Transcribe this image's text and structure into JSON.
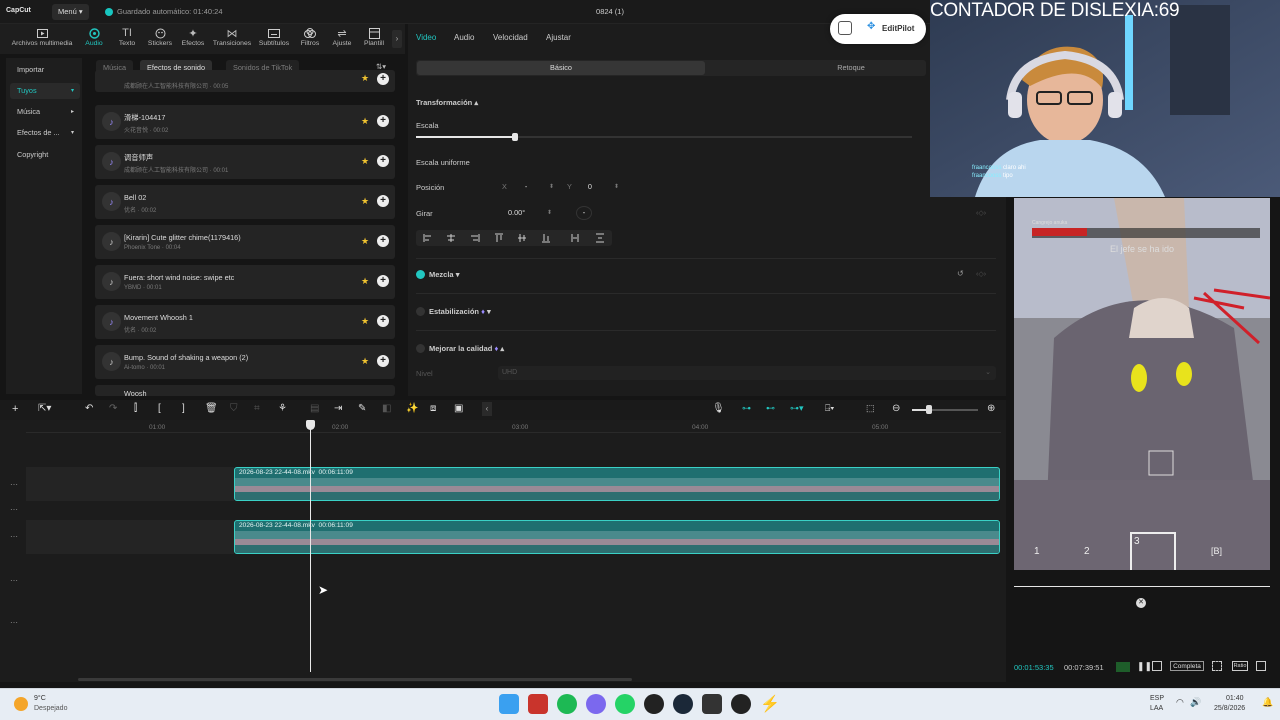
{
  "app": {
    "logo": "CapCut",
    "menu": "Menú",
    "autosave": "Guardado automático: 01:40:24",
    "project_title": "0824 (1)"
  },
  "media_tabs": [
    {
      "label": "Archivos multimedia",
      "icon": "media-icon"
    },
    {
      "label": "Audio",
      "icon": "audio-icon"
    },
    {
      "label": "Texto",
      "icon": "text-icon"
    },
    {
      "label": "Stickers",
      "icon": "sticker-icon"
    },
    {
      "label": "Efectos",
      "icon": "effects-icon"
    },
    {
      "label": "Transiciones",
      "icon": "transition-icon"
    },
    {
      "label": "Subtítulos",
      "icon": "subtitles-icon"
    },
    {
      "label": "Filtros",
      "icon": "filter-icon"
    },
    {
      "label": "Ajuste",
      "icon": "adjust-icon"
    },
    {
      "label": "Plantill",
      "icon": "template-icon"
    }
  ],
  "sidebar": {
    "items": [
      "Importar",
      "Tuyos",
      "Música",
      "Efectos de ...",
      "Copyright"
    ]
  },
  "subtabs": [
    "Música",
    "Efectos de sonido",
    "Sonidos de TikTok"
  ],
  "sounds": [
    {
      "title": "",
      "sub": "成都顾在人工智能科技有限公司 · 00:05"
    },
    {
      "title": "滑梯-104417",
      "sub": "火花音悦 · 00:02"
    },
    {
      "title": "调音师声",
      "sub": "成都顾在人工智能科技有限公司 · 00:01"
    },
    {
      "title": "Bell 02",
      "sub": "优名 · 00:02"
    },
    {
      "title": "[Kirarin] Cute glitter chime(1179416)",
      "sub": "Phoenix Tone · 00:04"
    },
    {
      "title": "Fuera: short wind noise: swipe etc",
      "sub": "YBMD · 00:01"
    },
    {
      "title": "Movement Whoosh 1",
      "sub": "优名 · 00:02"
    },
    {
      "title": "Bump. Sound of shaking a weapon (2)",
      "sub": "Ai-tomo · 00:01"
    },
    {
      "title": "Woosh",
      "sub": ""
    }
  ],
  "props": {
    "tabs": [
      "Video",
      "Audio",
      "Velocidad",
      "Ajustar"
    ],
    "segments": [
      "Básico",
      "Retoque"
    ],
    "transform": "Transformación",
    "scale": "Escala",
    "uniform_scale": "Escala uniforme",
    "position": "Posición",
    "x_label": "X",
    "x_value": "-",
    "y_label": "Y",
    "y_value": "0",
    "rotate": "Girar",
    "rotate_value": "0.00°",
    "rotate_dash": "-",
    "blend": "Mezcla",
    "stabilization": "Estabilización",
    "enhance": "Mejorar la calidad",
    "level_label": "Nivel",
    "level_value": "UHD",
    "scale_level": 0.2
  },
  "editpilot": "EditPilot",
  "overlay": {
    "counter": "CONTADOR DE DISLEXIA:69",
    "chat1_user": "fraancooss",
    "chat1_msg": "claro ahi",
    "chat2_user": "fraancooss",
    "chat2_msg": "tipo"
  },
  "game": {
    "boss_label": "Cangrejo anuka",
    "subtitle": "El jefe se ha ido",
    "hotbar": [
      "1",
      "2",
      "3",
      "[B]"
    ]
  },
  "preview": {
    "current_time": "00:01:53:35",
    "total_time": "00:07:39:51",
    "quality": "Completa",
    "ratio": "Ratio"
  },
  "timeline": {
    "ruler": [
      "01:00",
      "02:00",
      "03:00",
      "04:00",
      "05:00"
    ],
    "clips": [
      {
        "name": "2026-08-23 22-44-08.mkv",
        "duration": "00:06:11:09"
      },
      {
        "name": "2026-08-23 22-44-08.mkv",
        "duration": "00:06:11:09"
      }
    ]
  },
  "taskbar": {
    "temp": "9°C",
    "weather": "Despejado",
    "lang1": "ESP",
    "lang2": "LAA",
    "clock": "01:40",
    "date": "25/8/2026"
  },
  "colors": {
    "accent": "#22c7c1",
    "clip": "#1f6f70",
    "star": "#f0c330"
  }
}
